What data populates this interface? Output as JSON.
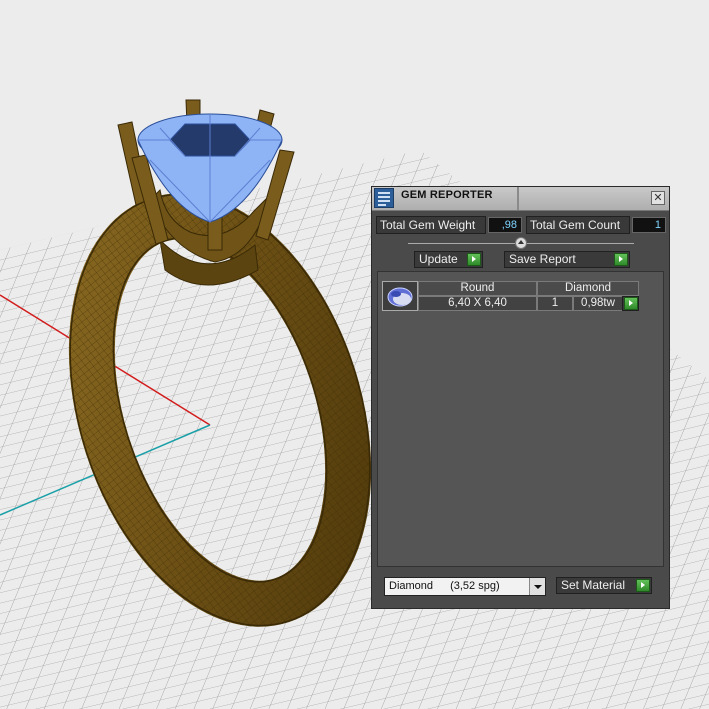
{
  "panel": {
    "title": "GEM REPORTER",
    "close_glyph": "✕",
    "total_gem_weight_label": "Total Gem Weight",
    "total_gem_weight_value": ",98",
    "total_gem_count_label": "Total Gem Count",
    "total_gem_count_value": "1",
    "update_label": "Update",
    "save_report_label": "Save Report",
    "gem_list": {
      "headers": {
        "cut": "Round",
        "material": "Diamond"
      },
      "rows": [
        {
          "size": "6,40 X 6,40",
          "count": "1",
          "weight": "0,98tw"
        }
      ]
    },
    "material_select": {
      "name": "Diamond",
      "detail": "(3,52 spg)"
    },
    "set_material_label": "Set Material"
  },
  "colors": {
    "ring_metal": "#6f5317",
    "gem": "#8fb4f5",
    "panel_bg": "#4a4a4a",
    "accent_green": "#3fa53a",
    "value_text": "#7fd4ff"
  },
  "icons": [
    "gem-reporter-icon",
    "close-icon",
    "go-arrow-icon",
    "gem-thumbnail-icon",
    "dropdown-arrow-icon"
  ]
}
